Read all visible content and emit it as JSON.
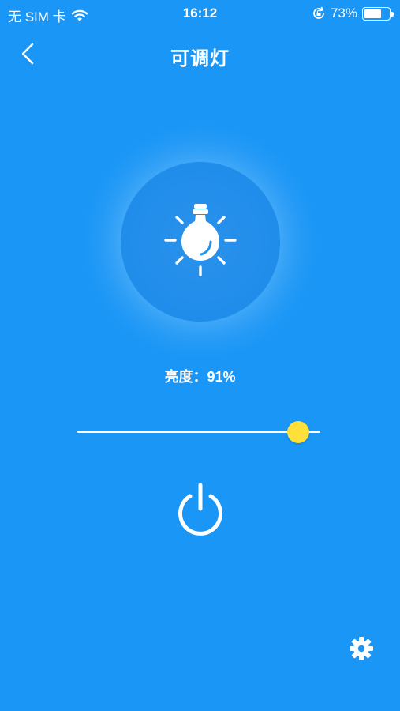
{
  "status_bar": {
    "carrier": "无 SIM 卡",
    "time": "16:12",
    "battery_percent": "73%",
    "battery_level": 0.73,
    "icons": [
      "wifi-icon",
      "orientation-lock-icon",
      "battery-icon"
    ]
  },
  "nav": {
    "title": "可调灯",
    "back_icon": "chevron-left-icon"
  },
  "bulb": {
    "icon": "light-bulb-icon"
  },
  "brightness": {
    "label": "亮度：91%",
    "value": 91,
    "max": 100
  },
  "power": {
    "icon": "power-icon"
  },
  "settings": {
    "icon": "gear-icon"
  },
  "colors": {
    "background": "#1A96F6",
    "slider_thumb": "#FFE03A",
    "foreground": "#FFFFFF"
  }
}
